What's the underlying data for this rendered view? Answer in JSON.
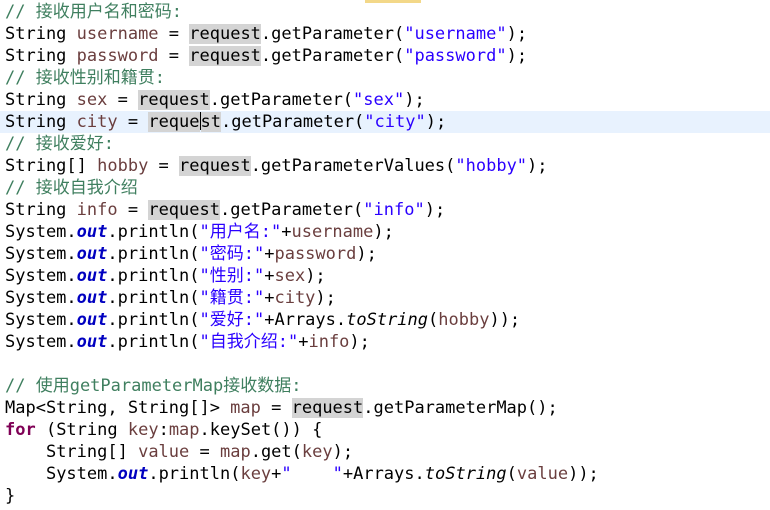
{
  "code": {
    "l1_comment": "// 接收用户名和密码:",
    "l2_type": "String ",
    "l2_var": "username",
    "l2_eq": " = ",
    "l2_req": "request",
    "l2_call": ".getParameter(",
    "l2_str": "\"username\"",
    "l2_end": ");",
    "l3_type": "String ",
    "l3_var": "password",
    "l3_eq": " = ",
    "l3_req": "request",
    "l3_call": ".getParameter(",
    "l3_str": "\"password\"",
    "l3_end": ");",
    "l4_comment": "// 接收性别和籍贯:",
    "l5_type": "String ",
    "l5_var": "sex",
    "l5_eq": " = ",
    "l5_req": "request",
    "l5_call": ".getParameter(",
    "l5_str": "\"sex\"",
    "l5_end": ");",
    "l6_type": "String ",
    "l6_var": "city",
    "l6_eq": " = ",
    "l6_req_a": "reque",
    "l6_req_b": "st",
    "l6_call": ".getParameter(",
    "l6_str": "\"city\"",
    "l6_end": ");",
    "l7_comment": "// 接收爱好:",
    "l8_type": "String[] ",
    "l8_var": "hobby",
    "l8_eq": " = ",
    "l8_req": "request",
    "l8_call": ".getParameterValues(",
    "l8_str": "\"hobby\"",
    "l8_end": ");",
    "l9_comment": "// 接收自我介绍",
    "l10_type": "String ",
    "l10_var": "info",
    "l10_eq": " = ",
    "l10_req": "request",
    "l10_call": ".getParameter(",
    "l10_str": "\"info\"",
    "l10_end": ");",
    "sys": "System.",
    "out": "out",
    "println": ".println(",
    "plus": "+",
    "close": ");",
    "l11_str": "\"用户名:\"",
    "l11_var": "username",
    "l12_str": "\"密码:\"",
    "l12_var": "password",
    "l13_str": "\"性别:\"",
    "l13_var": "sex",
    "l14_str": "\"籍贯:\"",
    "l14_var": "city",
    "l15_str": "\"爱好:\"",
    "l15_arrays": "Arrays.",
    "l15_tostring": "toString",
    "l15_open": "(",
    "l15_var": "hobby",
    "l15_end": "));",
    "l16_str": "\"自我介绍:\"",
    "l16_var": "info",
    "l18_comment": "// 使用getParameterMap接收数据:",
    "l19_type": "Map<String, String[]> ",
    "l19_var": "map",
    "l19_eq": " = ",
    "l19_req": "request",
    "l19_call": ".getParameterMap();",
    "l20_kw": "for",
    "l20_open": " (String ",
    "l20_key": "key",
    "l20_colon": ":",
    "l20_map": "map",
    "l20_rest": ".keySet()) {",
    "l21_indent": "    ",
    "l21_type": "String[] ",
    "l21_var": "value",
    "l21_eq": " = ",
    "l21_map": "map",
    "l21_get": ".get(",
    "l21_key": "key",
    "l21_end": ");",
    "l22_indent": "    ",
    "l22_key": "key",
    "l22_str": "\"    \"",
    "l22_arrays": "Arrays.",
    "l22_tostring": "toString",
    "l22_open": "(",
    "l22_var": "value",
    "l22_end": "));",
    "l23_brace": "}"
  }
}
